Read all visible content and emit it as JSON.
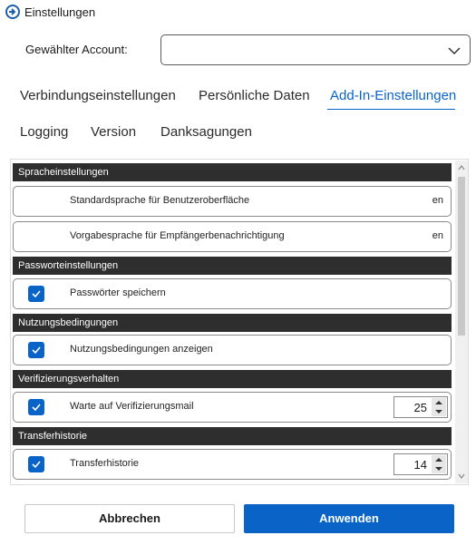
{
  "window": {
    "title": "Einstellungen"
  },
  "account": {
    "label": "Gewählter Account:",
    "value": ""
  },
  "tabs": [
    {
      "label": "Verbindungseinstellungen",
      "active": false
    },
    {
      "label": "Persönliche Daten",
      "active": false
    },
    {
      "label": "Add-In-Einstellungen",
      "active": true
    },
    {
      "label": "Logging",
      "active": false
    },
    {
      "label": "Version",
      "active": false
    },
    {
      "label": "Danksagungen",
      "active": false
    }
  ],
  "sections": {
    "language": {
      "header": "Spracheinstellungen",
      "ui_language": {
        "label": "Standardsprache für Benutzeroberfläche",
        "value": "en"
      },
      "recipient_language": {
        "label": "Vorgabesprache für Empfängerbenachrichtigung",
        "value": "en"
      }
    },
    "password": {
      "header": "Passworteinstellungen",
      "save_passwords": {
        "label": "Passwörter speichern",
        "checked": true
      }
    },
    "terms": {
      "header": "Nutzungsbedingungen",
      "show_terms": {
        "label": "Nutzungsbedingungen anzeigen",
        "checked": true
      }
    },
    "verification": {
      "header": "Verifizierungsverhalten",
      "wait_mail": {
        "label": "Warte auf Verifizierungsmail",
        "checked": true,
        "value": "25"
      }
    },
    "transfer": {
      "header": "Transferhistorie",
      "history": {
        "label": "Transferhistorie",
        "checked": true,
        "value": "14"
      }
    }
  },
  "buttons": {
    "cancel": "Abbrechen",
    "apply": "Anwenden"
  },
  "colors": {
    "accent": "#0a64c8",
    "section_header": "#2e2e2e"
  }
}
